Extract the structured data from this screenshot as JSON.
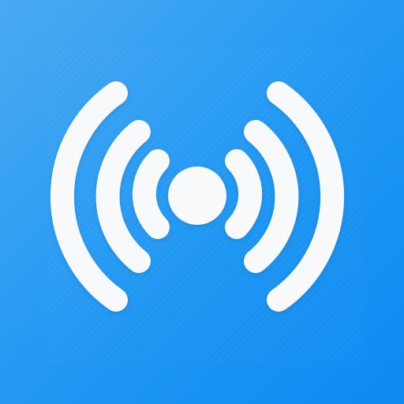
{
  "icon": {
    "name": "wifi-hotspot-broadcast-icon",
    "background_color": "#1f97f3",
    "background_gradient": [
      "#4aaaf2",
      "#0e8af1"
    ],
    "glyph_color": "#f7f9fb",
    "signal_waves_per_side": 3
  }
}
